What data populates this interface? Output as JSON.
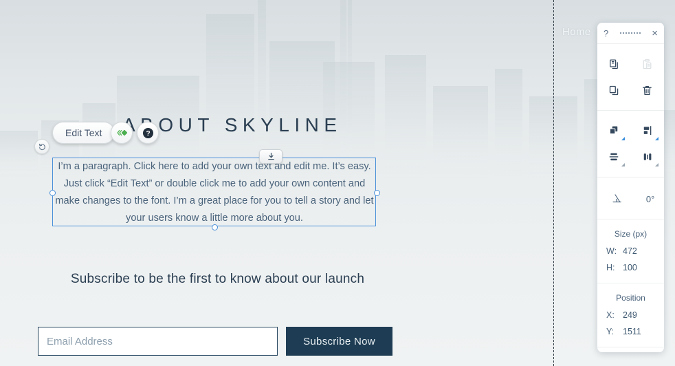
{
  "site": {
    "nav_home": "Home",
    "about_heading": "ABOUT SKYLINE",
    "paragraph": "I’m a paragraph. Click here to add your own text and edit me. It’s easy. Just click “Edit Text” or double click me to add your own content and make changes to the font. I’m a great place for you to tell a story and let your users know a little more about you.",
    "subscribe_heading": "Subscribe to be the first to know about our launch",
    "email_placeholder": "Email Address",
    "email_value": "",
    "subscribe_button": "Subscribe Now"
  },
  "editor_toolbar": {
    "edit_text_label": "Edit Text",
    "animation_icon": "animation-icon",
    "help_icon": "help-icon",
    "undo_icon": "undo-icon",
    "download_handle_icon": "download-icon"
  },
  "panel": {
    "header": {
      "help_icon": "question-mark-icon",
      "help_label": "?",
      "grip_icon": "drag-grip-icon",
      "close_icon": "close-icon",
      "close_label": "×"
    },
    "clipboard_tools": [
      {
        "name": "copy-icon",
        "enabled": true
      },
      {
        "name": "paste-icon",
        "enabled": false
      },
      {
        "name": "duplicate-icon",
        "enabled": true
      },
      {
        "name": "delete-icon",
        "enabled": true
      }
    ],
    "arrange_tools": [
      {
        "name": "arrange-layers-icon",
        "has_corner": true
      },
      {
        "name": "align-horizontal-icon",
        "has_corner": true
      },
      {
        "name": "distribute-vertical-icon",
        "has_corner": true
      },
      {
        "name": "distribute-horizontal-icon",
        "has_corner": true
      }
    ],
    "rotation": {
      "icon": "rotation-angle-icon",
      "value": "0°"
    },
    "size": {
      "title": "Size (px)",
      "width_label": "W:",
      "width_value": "472",
      "height_label": "H:",
      "height_value": "100"
    },
    "position": {
      "title": "Position",
      "x_label": "X:",
      "x_value": "249",
      "y_label": "Y:",
      "y_value": "1511"
    }
  },
  "colors": {
    "accent_navy": "#1e3d54",
    "selection_blue": "#4a90d9",
    "animation_green": "#4caf50",
    "panel_text": "#4a637b"
  }
}
